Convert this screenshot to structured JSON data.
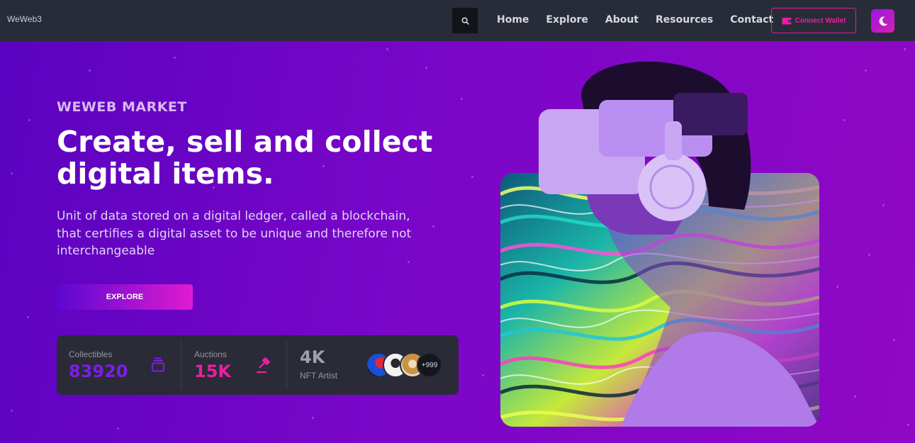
{
  "nav": {
    "brand": "WeWeb3",
    "links": [
      "Home",
      "Explore",
      "About",
      "Resources",
      "Contact"
    ],
    "wallet_label": "Connect Wallet"
  },
  "hero": {
    "kicker": "WEWEB MARKET",
    "headline": "Create, sell and collect digital items.",
    "description": "Unit of data stored on a digital ledger, called a blockchain, that certifies a digital asset to be unique and therefore not interchangeable",
    "cta": "EXPLORE"
  },
  "stats": {
    "collectibles": {
      "label": "Collectibles",
      "value": "83920"
    },
    "auctions": {
      "label": "Auctions",
      "value": "15K"
    },
    "artists": {
      "label": "NFT Artist",
      "value": "4K",
      "more": "+999"
    }
  },
  "colors": {
    "accent_pink": "#e81fa2",
    "accent_purple": "#7b1ee8",
    "navbar_bg": "#282c38"
  }
}
